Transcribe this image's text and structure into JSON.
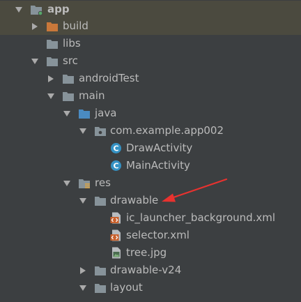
{
  "tree": {
    "items": [
      {
        "label": "app",
        "icon": "module-folder-icon",
        "expanded": true
      },
      {
        "label": "build",
        "icon": "excluded-folder-icon",
        "expanded": false
      },
      {
        "label": "libs",
        "icon": "folder-icon"
      },
      {
        "label": "src",
        "icon": "folder-icon",
        "expanded": true
      },
      {
        "label": "androidTest",
        "icon": "folder-icon",
        "expanded": false
      },
      {
        "label": "main",
        "icon": "folder-icon",
        "expanded": true
      },
      {
        "label": "java",
        "icon": "source-folder-icon",
        "expanded": true
      },
      {
        "label": "com.example.app002",
        "icon": "package-icon",
        "expanded": true
      },
      {
        "label": "DrawActivity",
        "icon": "class-icon"
      },
      {
        "label": "MainActivity",
        "icon": "class-icon"
      },
      {
        "label": "res",
        "icon": "resource-folder-icon",
        "expanded": true
      },
      {
        "label": "drawable",
        "icon": "folder-icon",
        "expanded": true
      },
      {
        "label": "ic_launcher_background.xml",
        "icon": "xml-file-icon"
      },
      {
        "label": "selector.xml",
        "icon": "xml-file-icon"
      },
      {
        "label": "tree.jpg",
        "icon": "image-file-icon"
      },
      {
        "label": "drawable-v24",
        "icon": "folder-icon",
        "expanded": false
      },
      {
        "label": "layout",
        "icon": "folder-icon",
        "expanded": true
      }
    ]
  },
  "colors": {
    "background": "#3c3f41",
    "selected_row": "#4b4a3f",
    "text": "#bbbbbb",
    "folder": "#87939a",
    "excluded_folder": "#c9783a",
    "source_folder": "#4a8bc2",
    "class_icon": "#3592c4",
    "xml_icon": "#c9612c",
    "annotation_arrow": "#e8322f"
  }
}
